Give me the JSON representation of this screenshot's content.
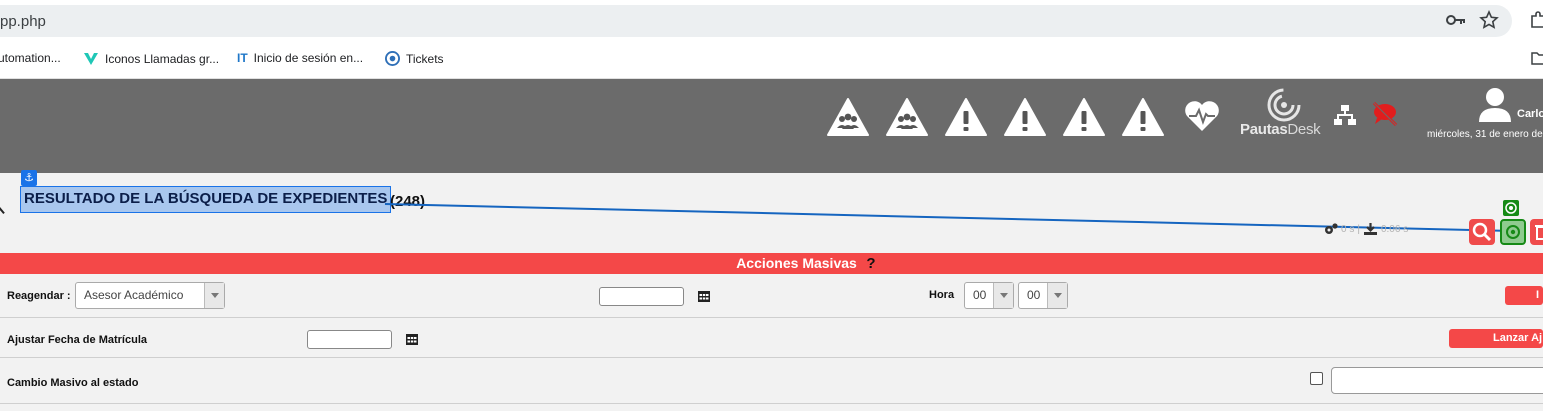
{
  "browser": {
    "url": "pp.php",
    "bookmarks": [
      {
        "label": "utomation..."
      },
      {
        "label": "Iconos Llamadas gr..."
      },
      {
        "label": "Inicio de sesión en..."
      },
      {
        "label": "Tickets"
      }
    ]
  },
  "header": {
    "logo_part1": "Pautas",
    "logo_part2": "Desk",
    "user_name": "Carlo",
    "user_date": "miércoles, 31 de enero de",
    "warning_icons": [
      "alert-group-icon",
      "alert-group-icon",
      "alert-exclamation-icon",
      "alert-exclamation-icon",
      "alert-exclamation-icon",
      "alert-exclamation-icon"
    ]
  },
  "results": {
    "title": "RESULTADO DE LA BÚSQUEDA DE EXPEDIENTES",
    "count": "(248)",
    "anchor_symbol": "⚓",
    "stats_time1": "0 s",
    "stats_time2": "0.06 s"
  },
  "mass_actions": {
    "title": "Acciones Masivas",
    "help": "?",
    "rows": {
      "reagendar": {
        "label": "Reagendar :",
        "select_value": "Asesor Académico",
        "hora_label": "Hora",
        "hour": "00",
        "minute": "00",
        "button": "I"
      },
      "ajustar": {
        "label": "Ajustar Fecha de Matrícula",
        "button": "Lanzar Aj"
      },
      "cambio": {
        "label": "Cambio Masivo al estado"
      }
    }
  },
  "colors": {
    "header_bg": "#6b6b6b",
    "accent_red": "#f44848",
    "highlight_blue": "#1a73e8"
  }
}
